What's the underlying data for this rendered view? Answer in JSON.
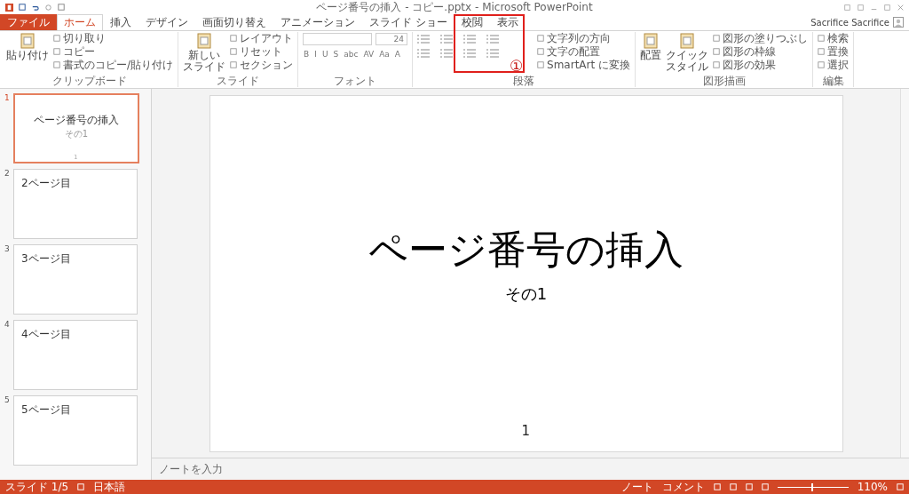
{
  "window": {
    "title": "ページ番号の挿入 - コピー.pptx - Microsoft PowerPoint",
    "user": "Sacrifice Sacrifice"
  },
  "tabs": [
    {
      "label": "ファイル",
      "kind": "file",
      "selected": false
    },
    {
      "label": "ホーム",
      "kind": "tab",
      "selected": true
    },
    {
      "label": "挿入",
      "kind": "tab",
      "selected": false
    },
    {
      "label": "デザイン",
      "kind": "tab",
      "selected": false
    },
    {
      "label": "画面切り替え",
      "kind": "tab",
      "selected": false
    },
    {
      "label": "アニメーション",
      "kind": "tab",
      "selected": false
    },
    {
      "label": "スライド ショー",
      "kind": "tab",
      "selected": false
    },
    {
      "label": "校閲",
      "kind": "tab",
      "selected": false
    },
    {
      "label": "表示",
      "kind": "tab",
      "selected": false
    }
  ],
  "ribbon": [
    {
      "kind": "clipboard",
      "label": "クリップボード",
      "big": [
        [
          "貼り付け"
        ]
      ],
      "small": [
        "切り取り",
        "コピー",
        "書式のコピー/貼り付け"
      ]
    },
    {
      "kind": "slides",
      "label": "スライド",
      "big": [
        [
          "新しい",
          "スライド"
        ]
      ],
      "small": [
        "レイアウト",
        "リセット",
        "セクション"
      ]
    },
    {
      "kind": "font",
      "label": "フォント",
      "font_size": "24",
      "format_buttons": [
        "B",
        "I",
        "U",
        "S",
        "abc",
        "AV",
        "Aa",
        "A"
      ]
    },
    {
      "kind": "paragraph",
      "label": "段落",
      "small": [
        "文字列の方向",
        "文字の配置",
        "SmartArt に変換"
      ]
    },
    {
      "kind": "drawing",
      "label": "図形描画",
      "big": [
        [
          "配置"
        ],
        [
          "クイック",
          "スタイル"
        ]
      ],
      "small": [
        "図形の塗りつぶし",
        "図形の枠線",
        "図形の効果"
      ]
    },
    {
      "kind": "editing",
      "label": "編集",
      "small": [
        "検索",
        "置換",
        "選択"
      ]
    }
  ],
  "annotation": {
    "marker": "①"
  },
  "slides": [
    {
      "number": "1",
      "selected": true,
      "title": "ページ番号の挿入",
      "subtitle": "その1",
      "page": "1"
    },
    {
      "number": "2",
      "selected": false,
      "title": "2ページ目"
    },
    {
      "number": "3",
      "selected": false,
      "title": "3ページ目"
    },
    {
      "number": "4",
      "selected": false,
      "title": "4ページ目"
    },
    {
      "number": "5",
      "selected": false,
      "title": "5ページ目"
    }
  ],
  "current_slide": {
    "title": "ページ番号の挿入",
    "subtitle": "その1",
    "page": "1"
  },
  "notes": {
    "placeholder": "ノートを入力"
  },
  "status_bar": {
    "slide": "スライド 1/5",
    "language": "日本語",
    "notes": "ノート",
    "comments": "コメント",
    "zoom": "110%",
    "level": 0.48
  }
}
